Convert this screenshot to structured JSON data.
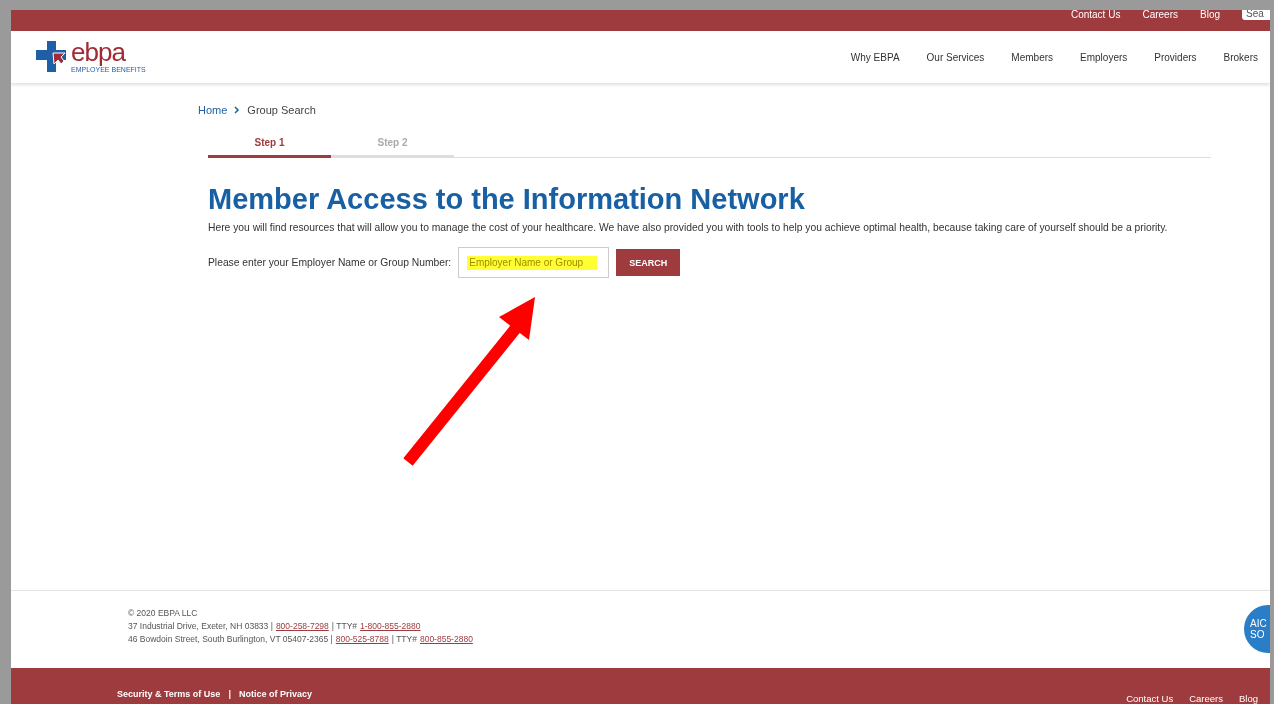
{
  "top_bar": {
    "links": [
      "Contact Us",
      "Careers",
      "Blog"
    ],
    "search": {
      "placeholder": "Sea"
    }
  },
  "header": {
    "logo": {
      "wordmark": "ebpa",
      "tagline_left": "EMPLOYEE",
      "tagline_right": "BENEFITS"
    },
    "nav": [
      "Why EBPA",
      "Our Services",
      "Members",
      "Employers",
      "Providers",
      "Brokers"
    ]
  },
  "breadcrumb": [
    "Home",
    "Group Search"
  ],
  "steps": [
    {
      "label": "Step 1",
      "selected": true
    },
    {
      "label": "Step 2",
      "selected": false
    }
  ],
  "title": "Member Access to the Information Network",
  "intro": "Here you will find resources that will allow you to manage the cost of your healthcare. We have also provided you with tools to help you achieve optimal health, because taking care of yourself should be a priority.",
  "form": {
    "label": "Please enter your Employer Name or Group Number:",
    "field": {
      "placeholder": "Employer Name or Group",
      "highlighted": true
    },
    "button": "SEARCH"
  },
  "annotation": {
    "arrow": true
  },
  "footer": {
    "copyright": "© 2020 EBPA LLC",
    "addresses": [
      {
        "address": "37 Industrial Drive, Exeter, NH 03833 |",
        "phone": "800-258-7298",
        "tty_label": "| TTY#",
        "tty": "1-800-855-2880"
      },
      {
        "address": "46 Bowdoin Street, South Burlington, VT 05407-2365 |",
        "phone": "800-525-8788",
        "tty_label": "| TTY#",
        "tty": "800-855-2880"
      }
    ],
    "badge": [
      "AIC",
      "SO"
    ]
  },
  "bottom_bar": {
    "left_links": [
      "Security & Terms of Use",
      "Notice of Privacy"
    ],
    "separator": "|",
    "right_links": [
      "Contact Us",
      "Careers",
      "Blog"
    ]
  }
}
